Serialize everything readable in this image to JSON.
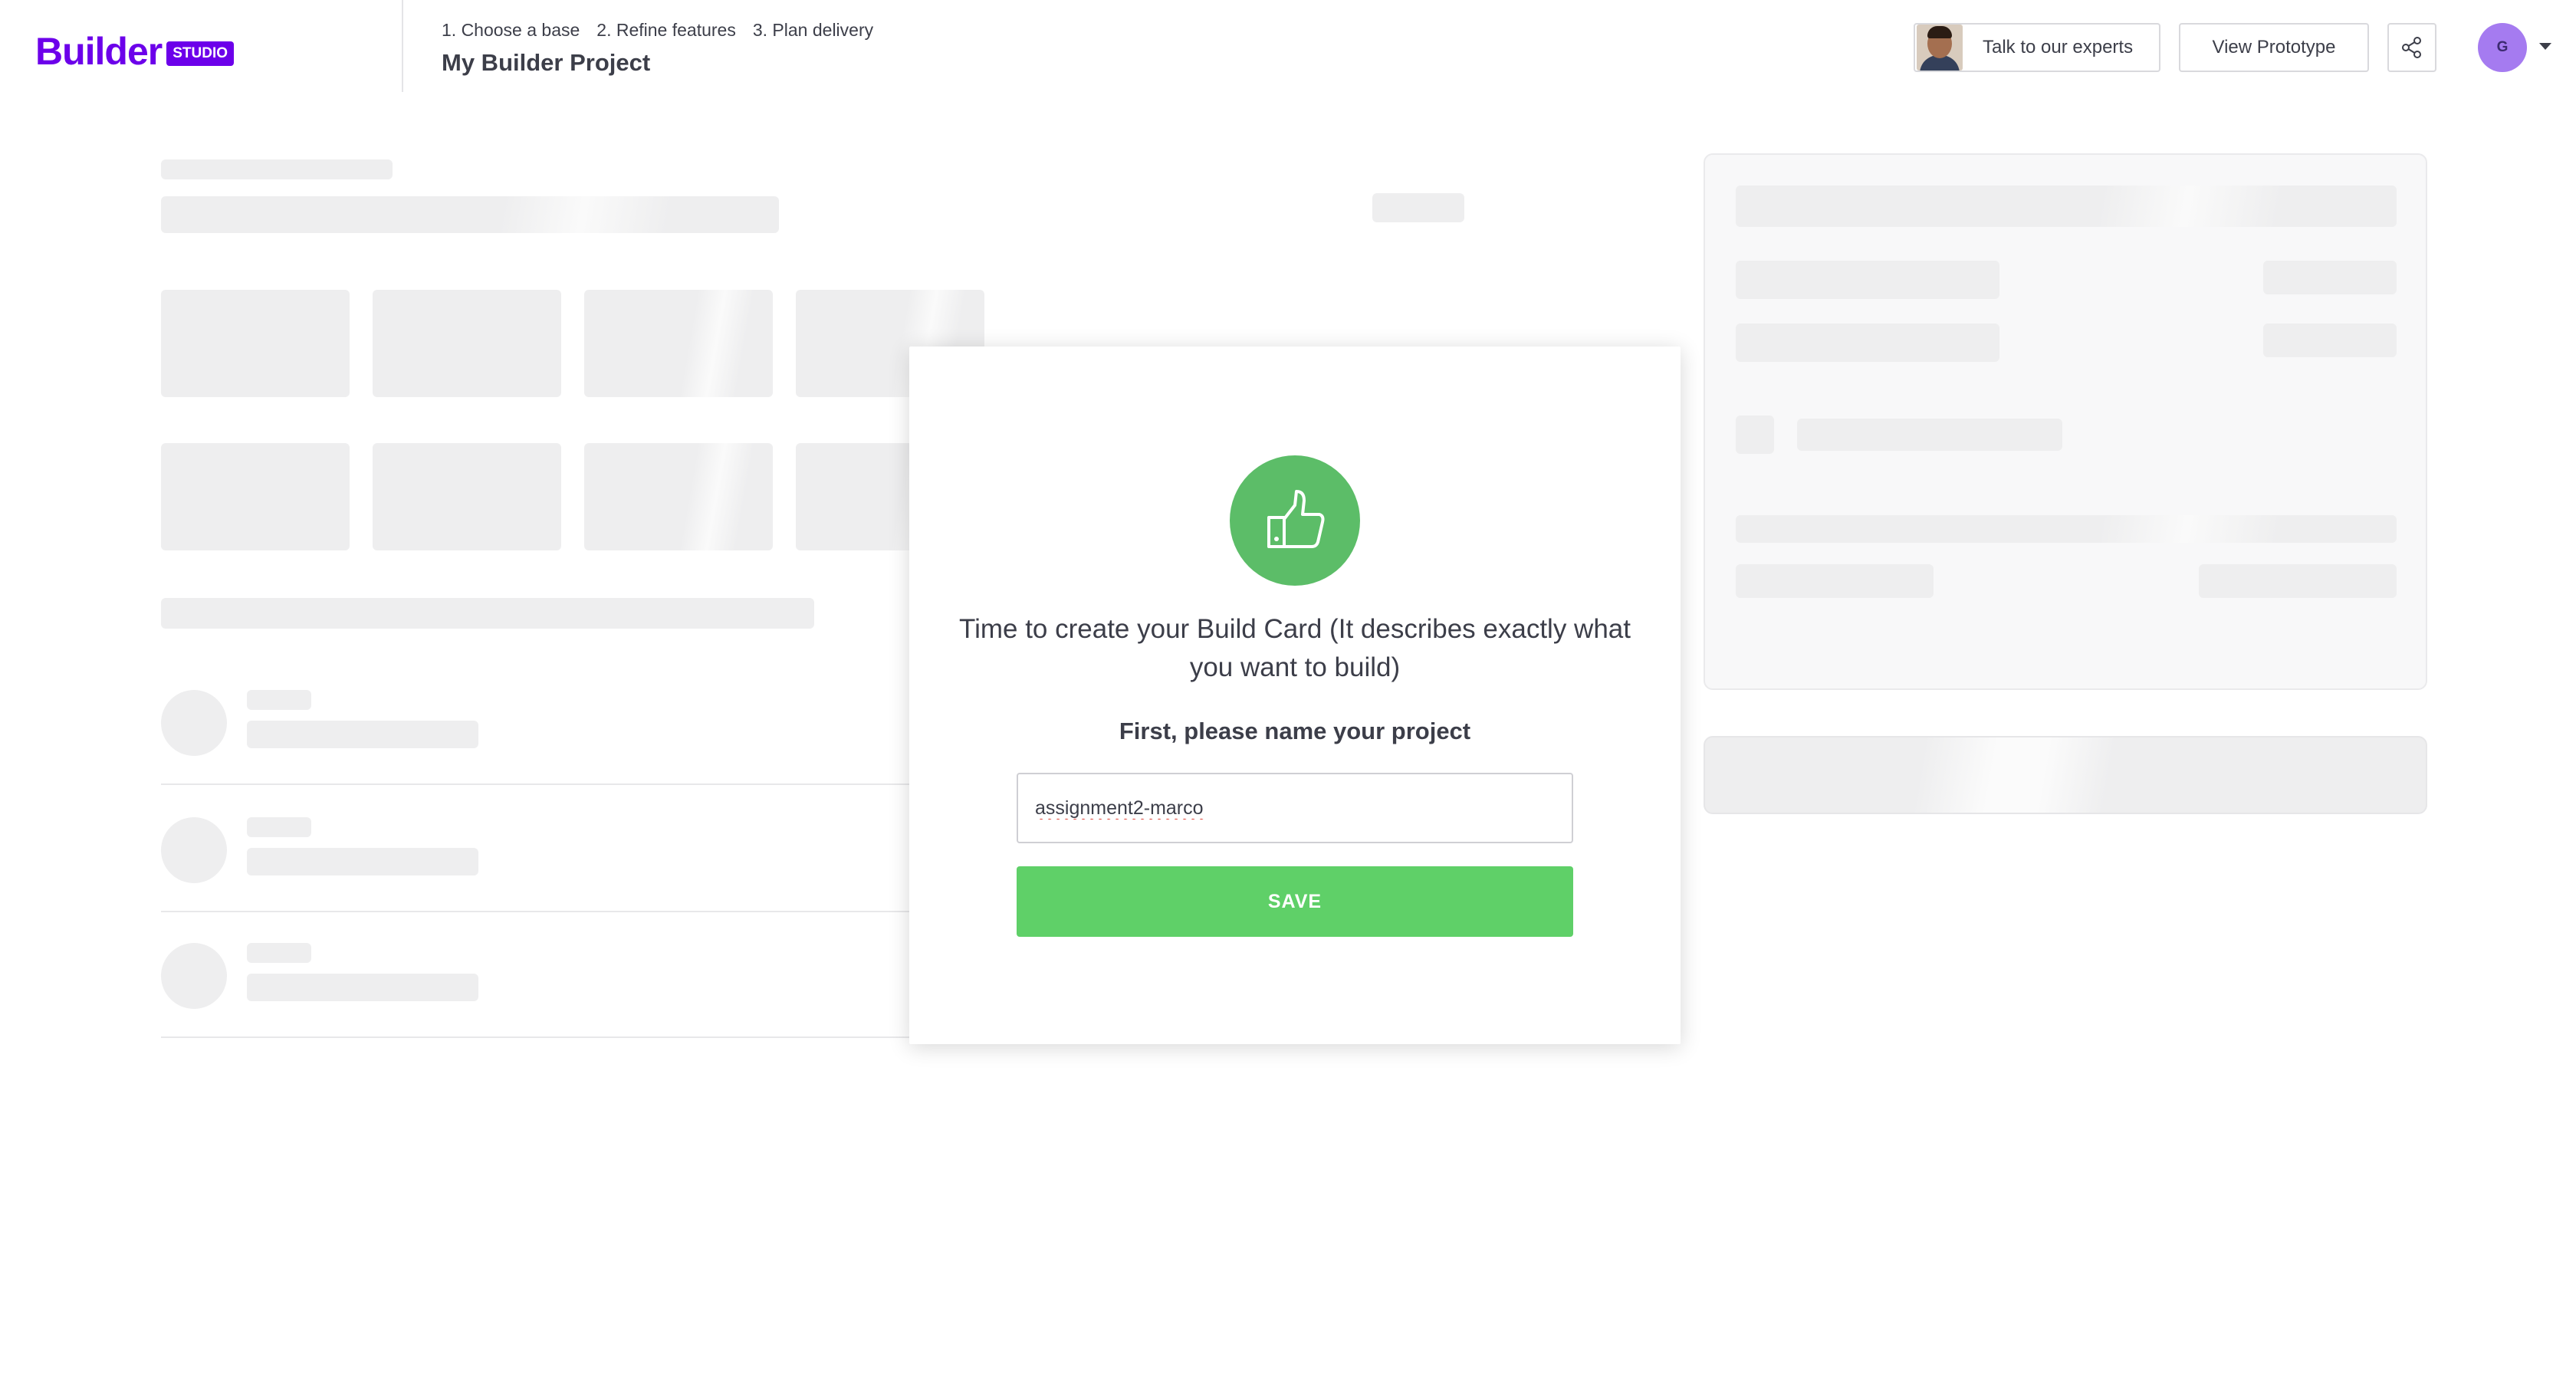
{
  "brand": {
    "name": "Builder",
    "badge": "STUDIO",
    "color": "#6c00ea"
  },
  "header": {
    "steps": [
      "1. Choose a base",
      "2. Refine features",
      "3. Plan delivery"
    ],
    "project_title": "My Builder Project",
    "experts_label": "Talk to our experts",
    "prototype_label": "View Prototype",
    "share_icon": "share-icon",
    "avatar_initial": "G"
  },
  "modal": {
    "icon": "thumbs-up-icon",
    "heading": "Time to create your Build Card (It describes exactly what you want to build)",
    "subheading": "First, please name your project",
    "project_name_value": "assignment2-marco",
    "save_label": "SAVE",
    "accent_color": "#5cbd68",
    "button_color": "#5fd068"
  }
}
